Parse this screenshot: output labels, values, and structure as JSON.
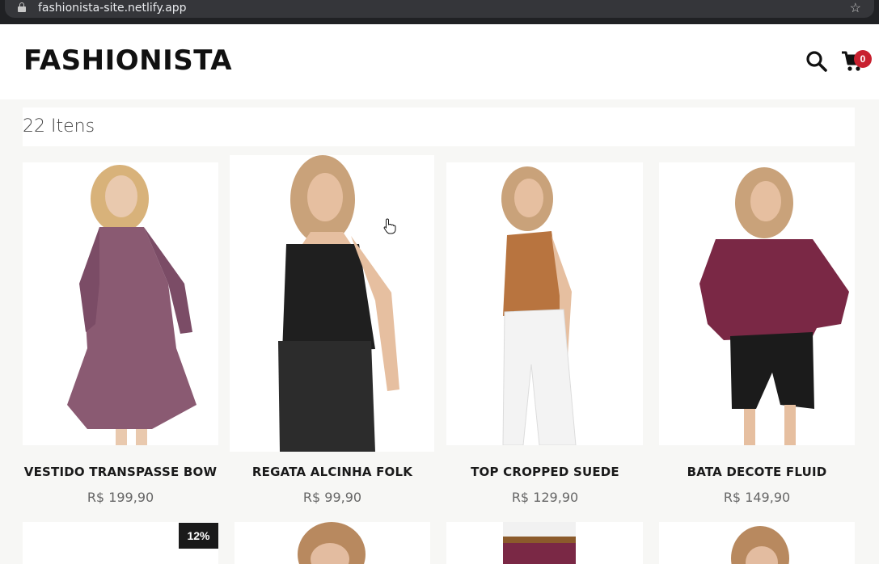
{
  "browser": {
    "url": "fashionista-site.netlify.app",
    "lock_icon": "lock-icon",
    "bookmark_icon": "star-icon"
  },
  "header": {
    "logo": "FASHIONISTA",
    "search_icon": "search-icon",
    "cart_icon": "cart-icon",
    "cart_count": "0"
  },
  "items_count_label": "22 Itens",
  "products": [
    {
      "name": "VESTIDO TRANSPASSE BOW",
      "price": "R$ 199,90"
    },
    {
      "name": "REGATA ALCINHA FOLK",
      "price": "R$ 99,90"
    },
    {
      "name": "TOP CROPPED SUEDE",
      "price": "R$ 129,90"
    },
    {
      "name": "BATA DECOTE FLUID",
      "price": "R$ 149,90"
    }
  ],
  "second_row": {
    "discount_badge": "12%"
  },
  "colors": {
    "accent_badge": "#c8202f",
    "background": "#f7f7f5",
    "text_dark": "#1a1a1a"
  }
}
